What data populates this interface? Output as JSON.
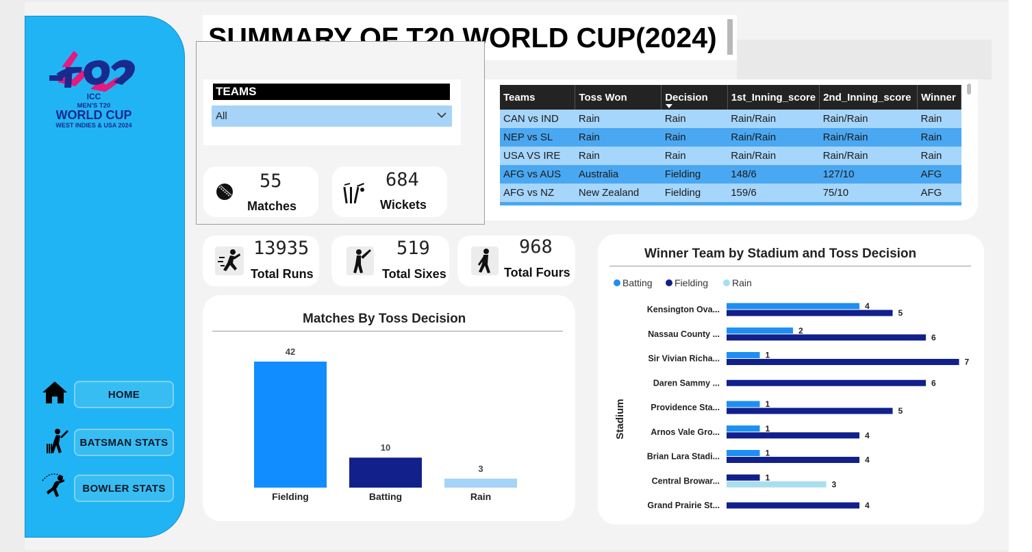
{
  "title": "SUMMARY OF T20 WORLD CUP(2024)",
  "logo": {
    "brand": "T20",
    "line1": "ICC",
    "line2": "MEN'S T20",
    "line3": "WORLD CUP",
    "line4": "WEST INDIES & USA 2024"
  },
  "nav": {
    "home": "HOME",
    "batsman": "BATSMAN STATS",
    "bowler": "BOWLER STATS"
  },
  "slicer": {
    "label": "TEAMS",
    "value": "All"
  },
  "kpis": {
    "matches": {
      "value": "55",
      "label": "Matches"
    },
    "wickets": {
      "value": "684",
      "label": "Wickets"
    },
    "runs": {
      "value": "13935",
      "label": "Total Runs"
    },
    "sixes": {
      "value": "519",
      "label": "Total Sixes"
    },
    "fours": {
      "value": "968",
      "label": "Total Fours"
    }
  },
  "table": {
    "headers": [
      "Teams",
      "Toss Won",
      "Decision",
      "1st_Inning_score",
      "2nd_Inning_score",
      "Winner"
    ],
    "rows": [
      [
        "CAN vs IND",
        "Rain",
        "Rain",
        "Rain/Rain",
        "Rain/Rain",
        "Rain"
      ],
      [
        "NEP vs SL",
        "Rain",
        "Rain",
        "Rain/Rain",
        "Rain/Rain",
        "Rain"
      ],
      [
        "USA VS IRE",
        "Rain",
        "Rain",
        "Rain/Rain",
        "Rain/Rain",
        "Rain"
      ],
      [
        "AFG vs AUS",
        "Australia",
        "Fielding",
        "148/6",
        "127/10",
        "AFG"
      ],
      [
        "AFG vs NZ",
        "New Zealand",
        "Fielding",
        "159/6",
        "75/10",
        "AFG"
      ]
    ]
  },
  "colors": {
    "sidebar": "#21b4f4",
    "batting": "#1e8ff2",
    "fielding": "#12208c",
    "rain": "#a8def0",
    "toss_fielding": "#118dff",
    "toss_batting": "#12208c",
    "toss_rain": "#a6d3f8"
  },
  "toss_chart_title": "Matches By Toss Decision",
  "stadium_chart_title": "Winner Team by Stadium and Toss Decision",
  "stadium_chart_ylabel": "Stadium",
  "chart_data": [
    {
      "type": "bar",
      "title": "Matches By Toss Decision",
      "categories": [
        "Fielding",
        "Batting",
        "Rain"
      ],
      "values": [
        42,
        10,
        3
      ],
      "xlabel": "",
      "ylabel": "",
      "data_labels": true
    },
    {
      "type": "bar",
      "orientation": "horizontal",
      "title": "Winner Team by Stadium and Toss Decision",
      "ylabel": "Stadium",
      "legend_position": "top-left",
      "categories": [
        "Kensington Ova...",
        "Nassau County ...",
        "Sir Vivian Richa...",
        "Daren Sammy ...",
        "Providence Sta...",
        "Arnos Vale Gro...",
        "Brian Lara Stadi...",
        "Central Browar...",
        "Grand Prairie St..."
      ],
      "series": [
        {
          "name": "Batting",
          "values": [
            4,
            2,
            1,
            null,
            1,
            1,
            1,
            null,
            null
          ]
        },
        {
          "name": "Fielding",
          "values": [
            5,
            6,
            7,
            6,
            5,
            4,
            4,
            1,
            4
          ]
        },
        {
          "name": "Rain",
          "values": [
            null,
            null,
            null,
            null,
            null,
            null,
            null,
            3,
            null
          ]
        }
      ]
    }
  ]
}
